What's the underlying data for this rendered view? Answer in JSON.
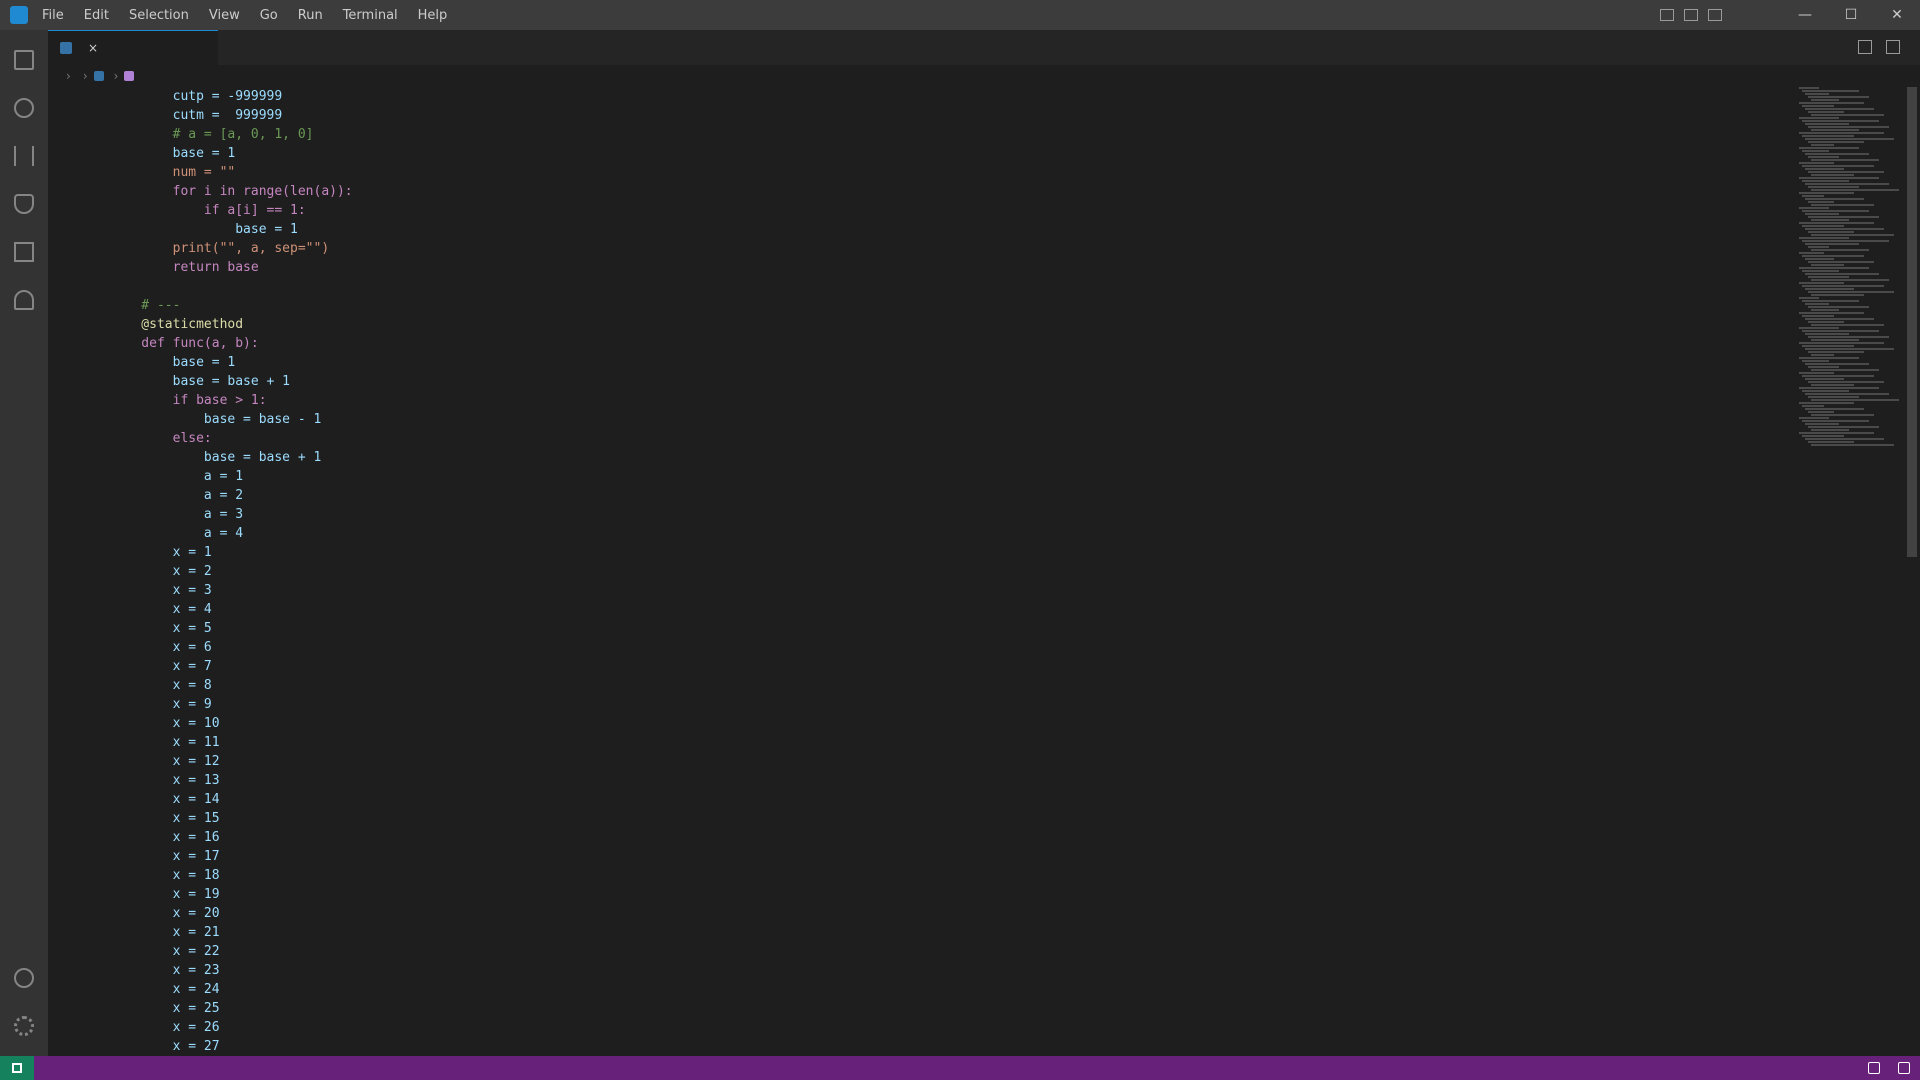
{
  "titlebar": {
    "menu": [
      "File",
      "Edit",
      "Selection",
      "View",
      "Go",
      "Run",
      "Terminal",
      "Help"
    ],
    "window_title": "",
    "controls": {
      "minimize": "—",
      "maximize": "☐",
      "close": "✕"
    }
  },
  "tab": {
    "label": "",
    "close": "×"
  },
  "breadcrumb": {
    "items": []
  },
  "gutter": {
    "lines": []
  },
  "code": {
    "lines": [
      "        cutp = -999999   ",
      "        cutm =  999999   ",
      "        # a = [a, 0, 1, 0]",
      "        base = 1",
      "        num = \"\"",
      "        for i in range(len(a)):",
      "            if a[i] == 1:",
      "                base = 1",
      "        print(\"\", a, sep=\"\")",
      "        return base",
      "",
      "    # ---",
      "    @staticmethod",
      "    def func(a, b):",
      "        base = 1",
      "        base = base + 1",
      "        if base > 1:",
      "            base = base - 1",
      "        else:",
      "            base = base + 1",
      "            a = 1",
      "            a = 2",
      "            a = 3",
      "            a = 4",
      "        x = 1",
      "        x = 2",
      "        x = 3",
      "        x = 4",
      "        x = 5",
      "        x = 6",
      "        x = 7",
      "        x = 8",
      "        x = 9",
      "        x = 10",
      "        x = 11",
      "        x = 12",
      "        x = 13",
      "        x = 14",
      "        x = 15",
      "        x = 16",
      "        x = 17",
      "        x = 18",
      "        x = 19",
      "        x = 20",
      "        x = 21",
      "        x = 22",
      "        x = 23",
      "        x = 24",
      "        x = 25",
      "        x = 26",
      "        x = 27"
    ]
  },
  "statusbar": {
    "left": "",
    "right": []
  }
}
